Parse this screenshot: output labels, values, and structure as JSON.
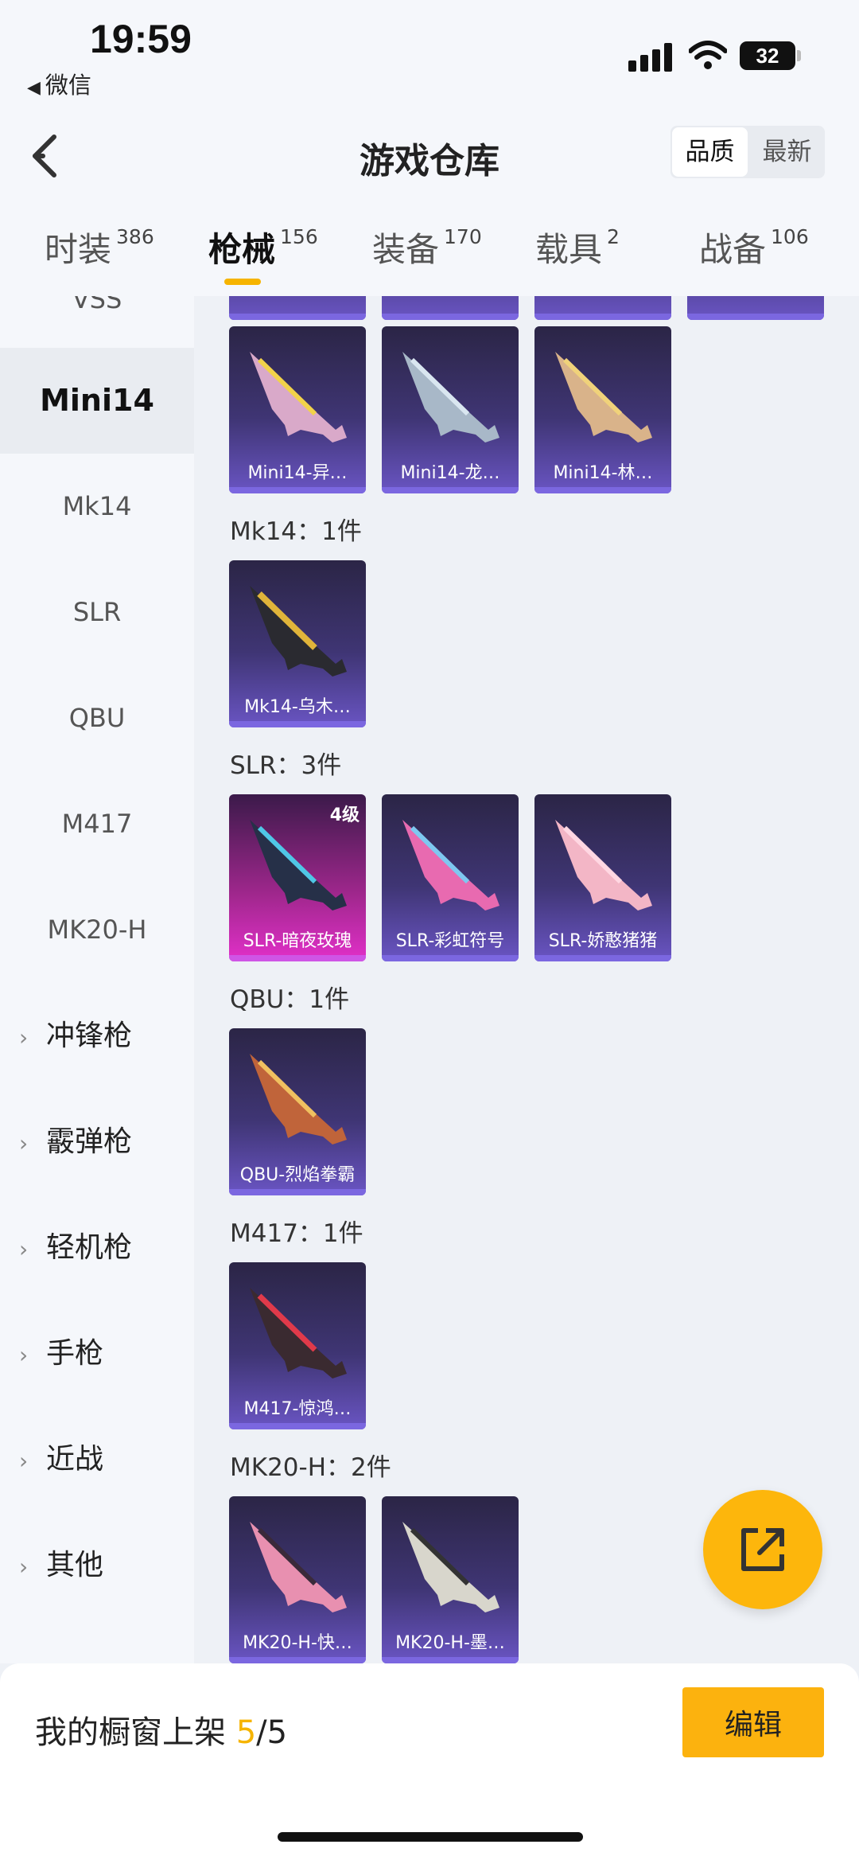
{
  "status_bar": {
    "time": "19:59",
    "back_app": "微信",
    "battery": "32"
  },
  "nav": {
    "title": "游戏仓库",
    "sort_options": [
      "品质",
      "最新"
    ],
    "active_sort": "品质"
  },
  "tabs": [
    {
      "label": "时装",
      "count": "386"
    },
    {
      "label": "枪械",
      "count": "156",
      "active": true
    },
    {
      "label": "装备",
      "count": "170"
    },
    {
      "label": "载具",
      "count": "2"
    },
    {
      "label": "战备",
      "count": "106"
    }
  ],
  "sidebar": {
    "partial_top": "VSS",
    "items": [
      "Mini14",
      "Mk14",
      "SLR",
      "QBU",
      "M417",
      "MK20-H"
    ],
    "active": "Mini14",
    "groups": [
      "冲锋枪",
      "霰弹枪",
      "轻机枪",
      "手枪",
      "近战",
      "其他"
    ]
  },
  "content": {
    "groups": [
      {
        "title": "Mk14：1件"
      },
      {
        "title": "SLR：3件"
      },
      {
        "title": "QBU：1件"
      },
      {
        "title": "M417：1件"
      },
      {
        "title": "MK20-H：2件"
      }
    ],
    "cards": {
      "mini14": [
        "Mini14-异…",
        "Mini14-龙…",
        "Mini14-林…"
      ],
      "mk14": [
        "Mk14-乌木…"
      ],
      "slr": [
        "SLR-暗夜玫瑰",
        "SLR-彩虹符号",
        "SLR-娇憨猪猪"
      ],
      "slr_level": "4级",
      "qbu": [
        "QBU-烈焰拳霸"
      ],
      "m417": [
        "M417-惊鸿…"
      ],
      "mk20": [
        "MK20-H-快…",
        "MK20-H-墨…"
      ]
    }
  },
  "bottom_bar": {
    "shelf_label": "我的橱窗上架",
    "shelf_count": "5",
    "shelf_total": "/5",
    "edit_label": "编辑"
  },
  "colors": {
    "accent": "#f6b400",
    "card_purple": "#6a55c4",
    "card_pink": "#e230c9"
  }
}
